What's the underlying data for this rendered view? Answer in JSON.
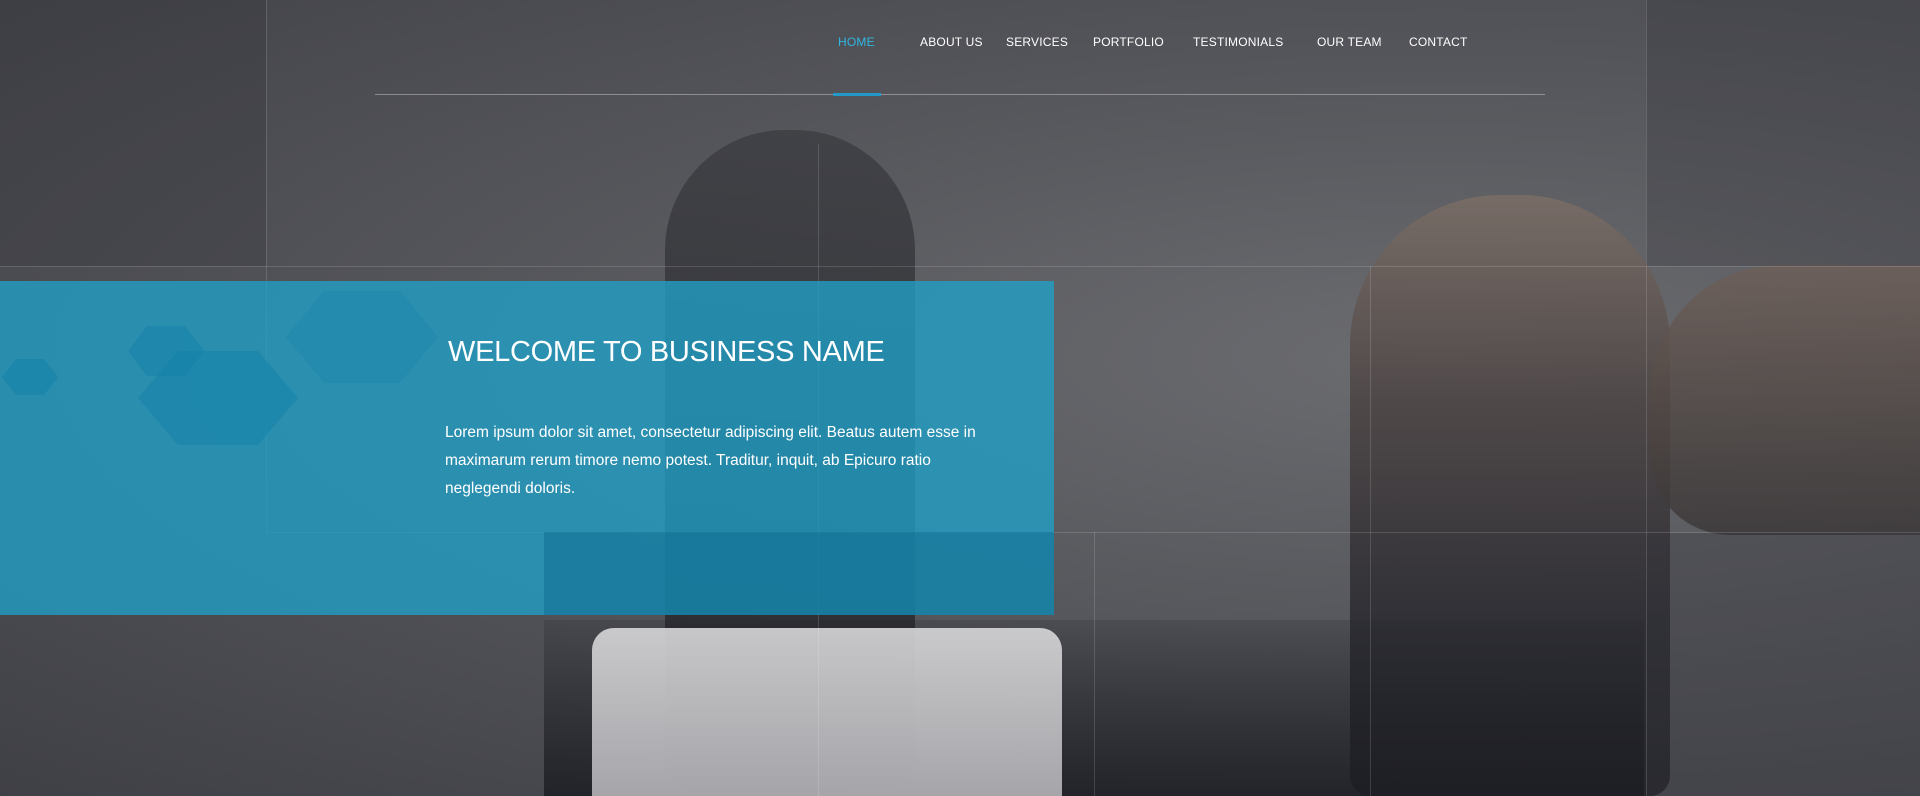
{
  "nav": {
    "items": [
      {
        "label": "HOME",
        "active": true
      },
      {
        "label": "ABOUT US",
        "active": false
      },
      {
        "label": "SERVICES",
        "active": false
      },
      {
        "label": "PORTFOLIO",
        "active": false
      },
      {
        "label": "TESTIMONIALS",
        "active": false
      },
      {
        "label": "OUR TEAM",
        "active": false
      },
      {
        "label": "CONTACT",
        "active": false
      }
    ]
  },
  "hero": {
    "title": "WELCOME TO BUSINESS NAME",
    "text": "Lorem ipsum dolor sit amet, consectetur adipiscing elit. Beatus autem esse in maximarum rerum timore nemo potest. Traditur, inquit, ab Epicuro ratio neglegendi doloris."
  },
  "colors": {
    "accent": "#2fb7e3",
    "panel": "#20a0c8",
    "text": "#ffffff"
  }
}
